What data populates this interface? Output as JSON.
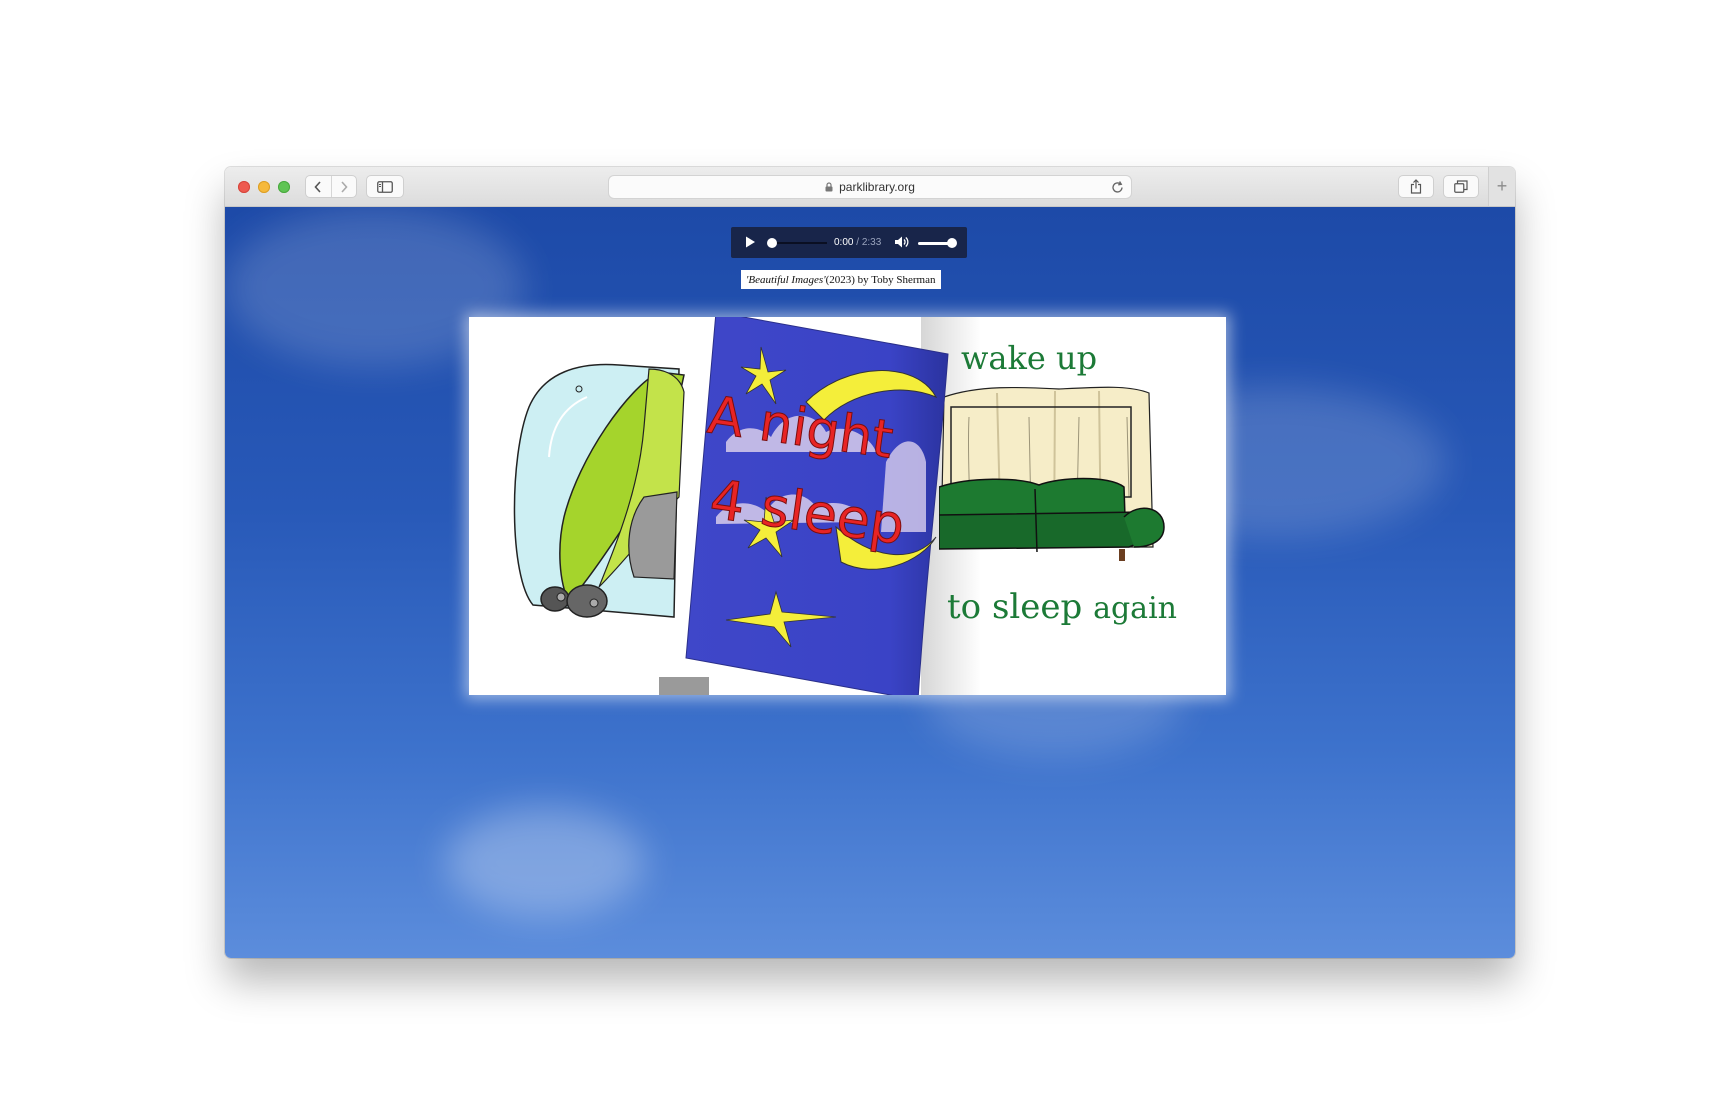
{
  "browser": {
    "url": "parklibrary.org"
  },
  "audio_player": {
    "current_time": "0:00",
    "separator": " / ",
    "duration": "2:33",
    "progress": 0.0,
    "volume": 1.0
  },
  "caption": {
    "title": "'Beautiful Images'",
    "rest": " (2023) by Toby Sherman"
  },
  "book": {
    "cover_title_line1": "A night",
    "cover_title_line2": "4 sleep",
    "page_text_top": "wake up",
    "page_text_bottom_a": "to sleep",
    "page_text_bottom_b": "again"
  },
  "colors": {
    "background_sky": "#2859b8",
    "cover_blue": "#3f47c9",
    "cover_red": "#e82424",
    "star_yellow": "#f4ee3a",
    "sofa_green": "#1d7a30",
    "text_green": "#1c7a37"
  },
  "icons": [
    "back-icon",
    "forward-icon",
    "sidebar-icon",
    "lock-icon",
    "reload-icon",
    "share-icon",
    "tabs-icon",
    "play-icon",
    "volume-icon"
  ]
}
